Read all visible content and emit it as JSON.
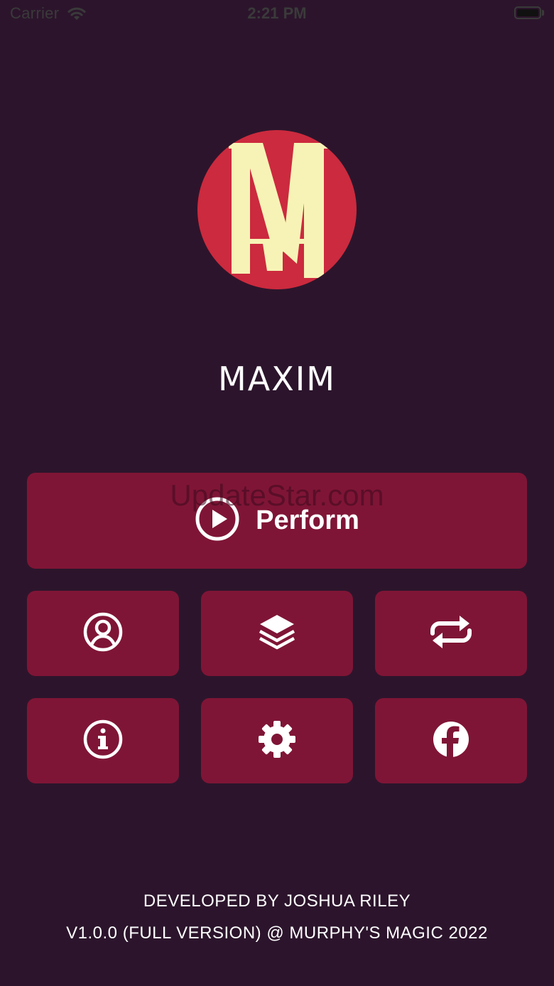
{
  "status_bar": {
    "carrier": "Carrier",
    "time": "2:21 PM",
    "wifi_icon": "wifi-icon",
    "battery_icon": "battery-icon"
  },
  "app": {
    "title": "MAXIM",
    "logo_text": "M",
    "logo_colors": {
      "circle": "#cc2a3e",
      "letter": "#f7f3b6"
    }
  },
  "perform_button": {
    "label": "Perform",
    "icon": "play-circle-icon"
  },
  "watermark": "UpdateStar.com",
  "grid_buttons": [
    {
      "icon": "user-circle-icon"
    },
    {
      "icon": "layers-icon"
    },
    {
      "icon": "repeat-icon"
    },
    {
      "icon": "info-circle-icon"
    },
    {
      "icon": "gear-icon"
    },
    {
      "icon": "facebook-icon"
    }
  ],
  "credits": {
    "developer": "DEVELOPED BY JOSHUA RILEY",
    "version": "V1.0.0 (FULL VERSION) @ MURPHY'S MAGIC 2022"
  },
  "colors": {
    "background": "#2c152c",
    "button": "#7f1536",
    "text": "#ffffff"
  }
}
